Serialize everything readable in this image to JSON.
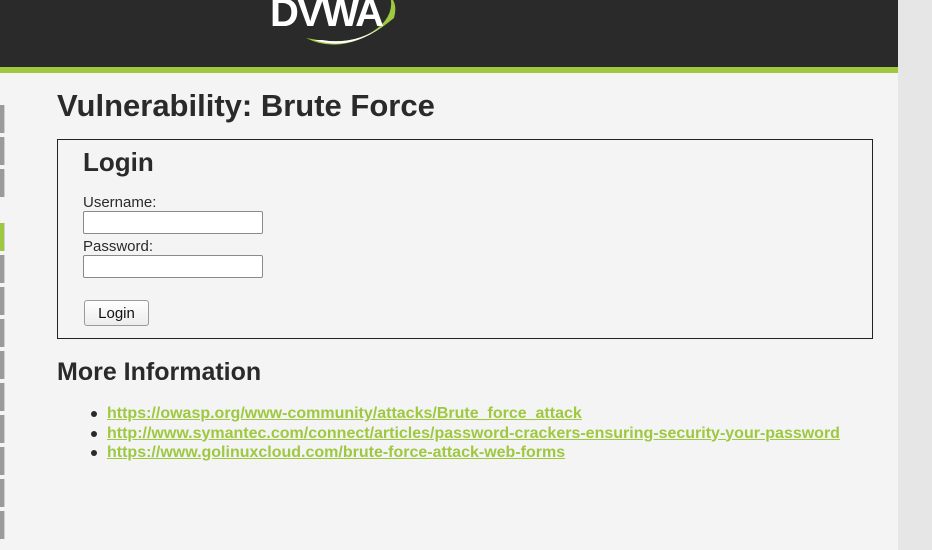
{
  "header": {
    "logo_text": "DVWA",
    "accent_color": "#9ec83f",
    "background_color": "#2a2a2a"
  },
  "page": {
    "title": "Vulnerability: Brute Force"
  },
  "login": {
    "heading": "Login",
    "username_label": "Username:",
    "username_value": "",
    "password_label": "Password:",
    "password_value": "",
    "button_label": "Login"
  },
  "more_info": {
    "heading": "More Information",
    "links": [
      "https://owasp.org/www-community/attacks/Brute_force_attack",
      "http://www.symantec.com/connect/articles/password-crackers-ensuring-security-your-password",
      "https://www.golinuxcloud.com/brute-force-attack-web-forms"
    ]
  },
  "sidebar": {
    "active_tab": "brute-force"
  }
}
